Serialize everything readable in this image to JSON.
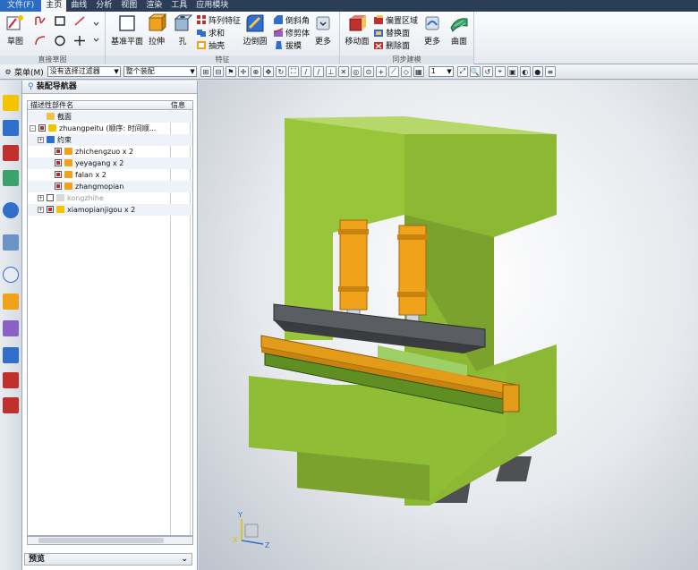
{
  "menubar": {
    "items": [
      {
        "label": "文件(F)",
        "kind": "file"
      },
      {
        "label": "主页",
        "kind": "active"
      },
      {
        "label": "曲线",
        "kind": ""
      },
      {
        "label": "分析",
        "kind": ""
      },
      {
        "label": "视图",
        "kind": ""
      },
      {
        "label": "渲染",
        "kind": ""
      },
      {
        "label": "工具",
        "kind": ""
      },
      {
        "label": "应用模块",
        "kind": ""
      }
    ]
  },
  "ribbon": {
    "sketch_label": "草图",
    "direct_sketch_group": "直接草图",
    "datum_plane_label": "基准平面",
    "extrude_label": "拉伸",
    "hole_label": "孔",
    "pattern_feature_label": "阵列特征",
    "unite_label": "求和",
    "shell_label": "抽壳",
    "edge_blend_label": "边倒圆",
    "chamfer_label": "倒斜角",
    "trim_body_label": "修剪体",
    "draft_label": "拔模",
    "more_label_1": "更多",
    "feature_group": "特征",
    "move_face_label": "移动面",
    "offset_region_label": "偏置区域",
    "replace_face_label": "替换面",
    "delete_face_label": "删除面",
    "more_label_2": "更多",
    "surface_label": "曲面",
    "sync_group": "同步建模"
  },
  "selbar": {
    "menu_label": "菜单(M)",
    "filter_value": "没有选择过滤器",
    "scope_value": "整个装配",
    "count_value": "1"
  },
  "navigator": {
    "title": "装配导航器",
    "col_name": "描述性部件名",
    "col_info": "信息",
    "rows": [
      {
        "label": "截面",
        "indent": 1,
        "expand": "",
        "check": "none",
        "icon": "folder",
        "dim": false
      },
      {
        "label": "zhuangpeitu (顺序: 时间顺...",
        "indent": 0,
        "expand": "-",
        "check": "on",
        "icon": "asm",
        "dim": false
      },
      {
        "label": "约束",
        "indent": 1,
        "expand": "+",
        "check": "none",
        "icon": "constraint",
        "dim": false
      },
      {
        "label": "zhichengzuo x 2",
        "indent": 2,
        "expand": "",
        "check": "on",
        "icon": "part",
        "dim": false
      },
      {
        "label": "yeyagang x 2",
        "indent": 2,
        "expand": "",
        "check": "on",
        "icon": "part",
        "dim": false
      },
      {
        "label": "falan x 2",
        "indent": 2,
        "expand": "",
        "check": "on",
        "icon": "part",
        "dim": false
      },
      {
        "label": "zhangmopian",
        "indent": 2,
        "expand": "",
        "check": "on",
        "icon": "part",
        "dim": false
      },
      {
        "label": "kongzhihe",
        "indent": 1,
        "expand": "+",
        "check": "off",
        "icon": "part-dim",
        "dim": true
      },
      {
        "label": "xiamopianjigou x 2",
        "indent": 1,
        "expand": "+",
        "check": "on",
        "icon": "asm",
        "dim": false
      }
    ]
  },
  "preview": {
    "label": "预览"
  },
  "colors": {
    "machine_green": "#98c53a",
    "machine_shadow": "#6f9426",
    "cylinder_orange": "#f0a21b",
    "ram_gray": "#4a4d52",
    "rail_orange": "#e39b1a"
  },
  "triad": {
    "x": "X",
    "y": "Y",
    "z": "Z"
  }
}
